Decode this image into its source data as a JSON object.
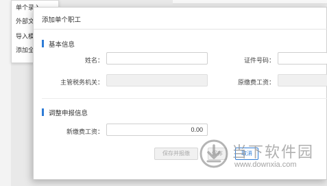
{
  "background_menu": {
    "items": [
      {
        "label": "单个录入"
      },
      {
        "label": "外部文"
      },
      {
        "label": "导入模"
      },
      {
        "label": "添加全"
      }
    ]
  },
  "dialog": {
    "title": "添加单个职工",
    "sections": {
      "basic": {
        "title": "基本信息",
        "name_label": "姓名：",
        "name_value": "",
        "id_label": "证件号码：",
        "id_value": "",
        "tax_office_label": "主管税务机关：",
        "tax_office_value": "",
        "original_wage_label": "原缴费工资：",
        "original_wage_value": ""
      },
      "adjust": {
        "title": "调整申报信息",
        "new_wage_label": "新缴费工资：",
        "new_wage_value": "0.00"
      }
    },
    "buttons": {
      "save_submit": "保存并报缴",
      "save": "保存",
      "cancel": "取消"
    }
  },
  "watermark": {
    "title": "当下软件园",
    "url": "www.downxia.com"
  },
  "colors": {
    "accent": "#2d7bd6",
    "disabled_bg": "#f0f0f0"
  }
}
